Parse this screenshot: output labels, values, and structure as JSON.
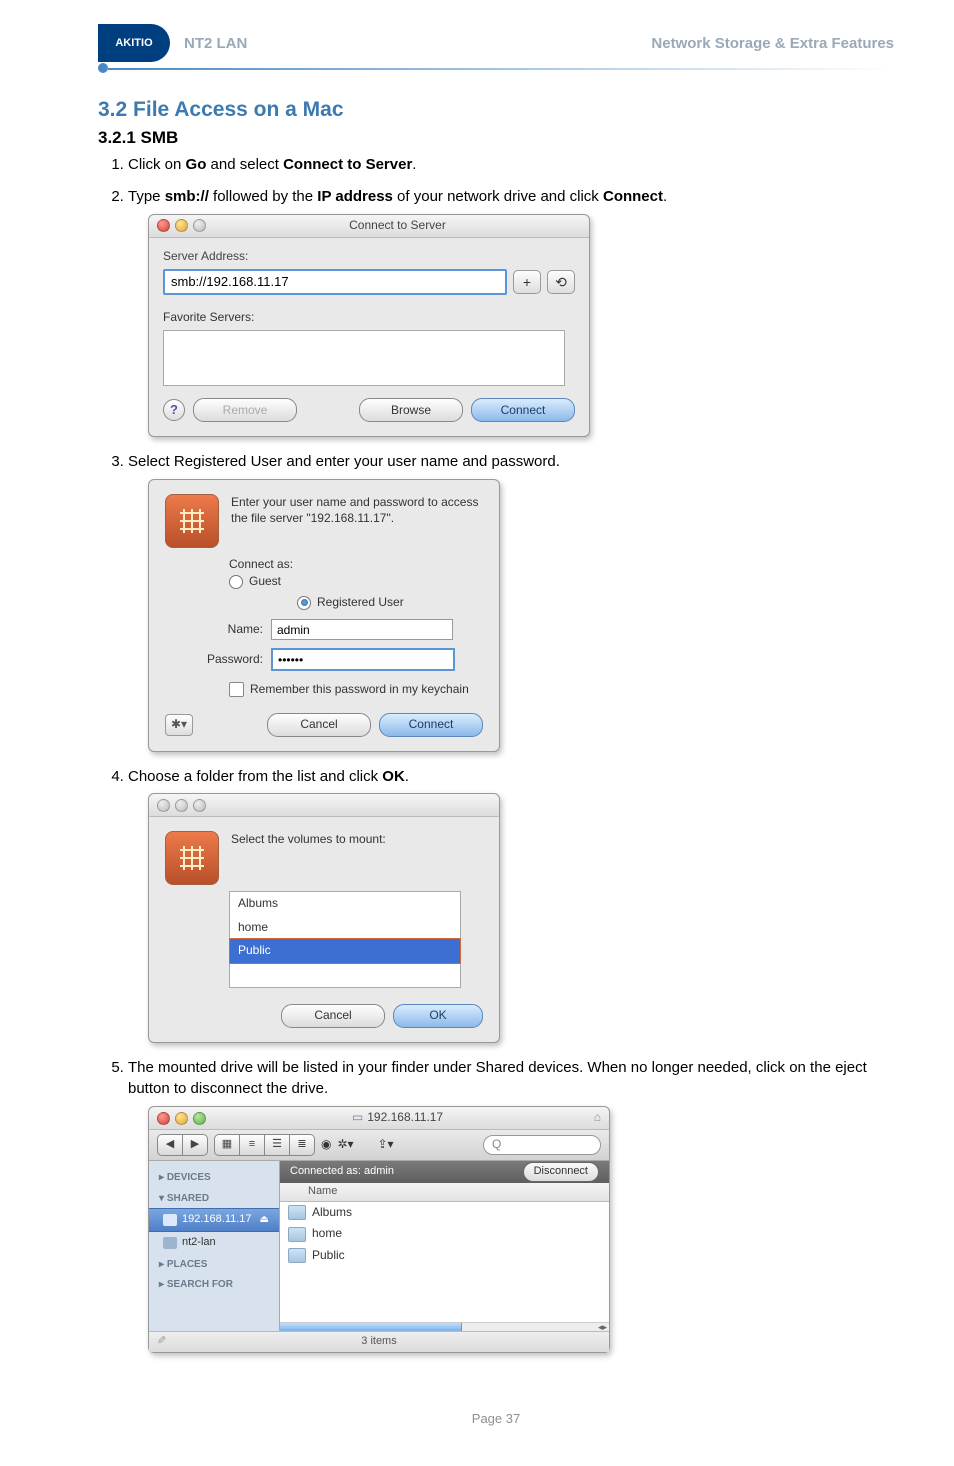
{
  "header": {
    "logo": "AKITIO",
    "left": "NT2 LAN",
    "right": "Network Storage & Extra Features"
  },
  "section": {
    "num_title": "3.2  File Access on a Mac",
    "sub": "3.2.1   SMB"
  },
  "steps": {
    "s1_a": "Click on ",
    "s1_b": "Go",
    "s1_c": " and select ",
    "s1_d": "Connect to Server",
    "s1_e": ".",
    "s2_a": "Type ",
    "s2_b": "smb://",
    "s2_c": " followed by the ",
    "s2_d": "IP address",
    "s2_e": " of your network drive and click ",
    "s2_f": "Connect",
    "s2_g": ".",
    "s3": "Select Registered User and enter your user name and password.",
    "s4_a": "Choose a folder from the list and click ",
    "s4_b": "OK",
    "s4_c": ".",
    "s5": "The mounted drive will be listed in your finder under Shared devices. When no longer needed, click on the eject button to disconnect the drive."
  },
  "connect_server": {
    "title": "Connect to Server",
    "addr_label": "Server Address:",
    "addr_value": "smb://192.168.11.17",
    "plus": "+",
    "clock": "⟲",
    "fav_label": "Favorite Servers:",
    "remove": "Remove",
    "browse": "Browse",
    "connect": "Connect",
    "help": "?"
  },
  "auth": {
    "msg": "Enter your user name and password to access the file server \"192.168.11.17\".",
    "connect_as": "Connect as:",
    "guest": "Guest",
    "registered": "Registered User",
    "name_label": "Name:",
    "name_value": "admin",
    "pass_label": "Password:",
    "pass_value": "••••••",
    "remember": "Remember this password in my keychain",
    "cancel": "Cancel",
    "connect": "Connect",
    "gear": "✱▾"
  },
  "mount": {
    "msg": "Select the volumes to mount:",
    "items": [
      "Albums",
      "home",
      "Public"
    ],
    "cancel": "Cancel",
    "ok": "OK"
  },
  "finder": {
    "title": "192.168.11.17",
    "connected_as": "Connected as: admin",
    "disconnect": "Disconnect",
    "col_name": "Name",
    "sidebar": {
      "devices": "DEVICES",
      "shared": "SHARED",
      "places": "PLACES",
      "searchfor": "SEARCH FOR",
      "ip": "192.168.11.17",
      "nt2": "nt2-lan"
    },
    "entries": [
      "Albums",
      "home",
      "Public"
    ],
    "status": "3 items",
    "search_ph": "Q",
    "tri_back": "◀",
    "tri_fwd": "▶",
    "icon1": "▦",
    "icon2": "≡",
    "icon3": "☰",
    "icon4": "≣",
    "eye": "◉",
    "gear": "✲▾",
    "qlook": "⇪▾",
    "proxy": "▭"
  },
  "footer": {
    "page": "Page 37"
  }
}
